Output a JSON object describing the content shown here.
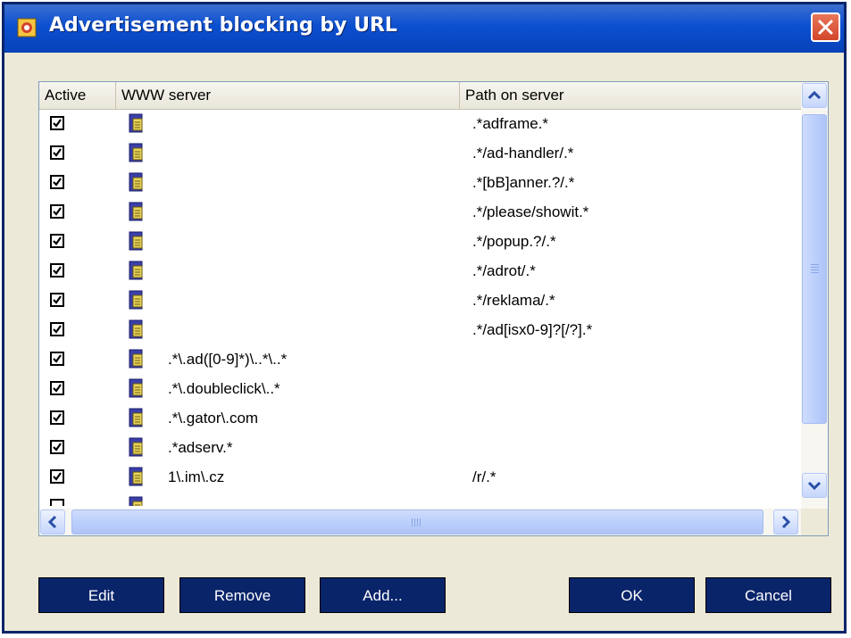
{
  "window": {
    "title": "Advertisement blocking by URL",
    "title_icon": "app-icon",
    "close_icon": "close-icon"
  },
  "list": {
    "columns": [
      "Active",
      "WWW server",
      "Path on server"
    ],
    "rows": [
      {
        "active": true,
        "server": "",
        "path": ".*adframe.*"
      },
      {
        "active": true,
        "server": "",
        "path": ".*/ad-handler/.*"
      },
      {
        "active": true,
        "server": "",
        "path": ".*[bB]anner.?/.*"
      },
      {
        "active": true,
        "server": "",
        "path": ".*/please/showit.*"
      },
      {
        "active": true,
        "server": "",
        "path": ".*/popup.?/.*"
      },
      {
        "active": true,
        "server": "",
        "path": ".*/adrot/.*"
      },
      {
        "active": true,
        "server": "",
        "path": ".*/reklama/.*"
      },
      {
        "active": true,
        "server": "",
        "path": ".*/ad[isx0-9]?[/?].*"
      },
      {
        "active": true,
        "server": ".*\\.ad([0-9]*)\\..*\\..*",
        "path": ""
      },
      {
        "active": true,
        "server": ".*\\.doubleclick\\..*",
        "path": ""
      },
      {
        "active": true,
        "server": ".*\\.gator\\.com",
        "path": ""
      },
      {
        "active": true,
        "server": ".*adserv.*",
        "path": ""
      },
      {
        "active": true,
        "server": "1\\.im\\.cz",
        "path": "/r/.*"
      }
    ],
    "row_icon": "server-icon"
  },
  "buttons": {
    "edit": "Edit",
    "remove": "Remove",
    "add": "Add...",
    "ok": "OK",
    "cancel": "Cancel"
  },
  "colors": {
    "titlebar": "#0a4fd0",
    "button_bg": "#0a246a",
    "dialog_bg": "#ece9d8"
  }
}
